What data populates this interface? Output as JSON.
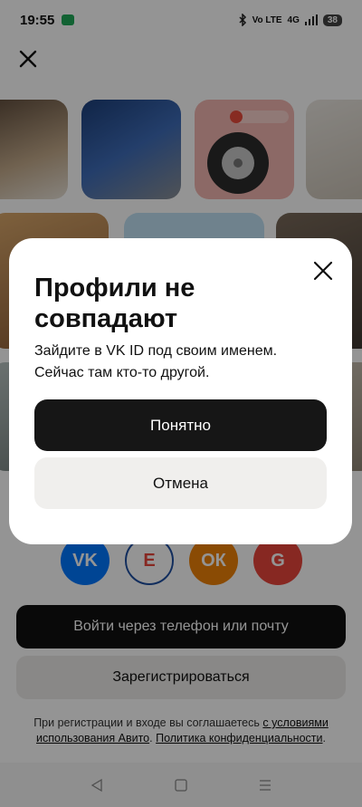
{
  "status_bar": {
    "time": "19:55",
    "network": "4G",
    "volte": "Vo LTE",
    "battery": "38"
  },
  "login": {
    "phone_button": "Войти через телефон или почту",
    "register_button": "Зарегистрироваться",
    "terms_prefix": "При регистрации и входе вы соглашаетесь ",
    "terms_link1": "с условиями использования Авито",
    "terms_middle": ". ",
    "terms_link2": "Политика конфиденциальности",
    "terms_suffix": ".",
    "social": [
      {
        "label": "VK",
        "color": "#0077ff"
      },
      {
        "label": "Е",
        "color": "#ffffff"
      },
      {
        "label": "ОК",
        "color": "#ee8208"
      },
      {
        "label": "G",
        "color": "#e8453c"
      }
    ]
  },
  "dialog": {
    "title": "Профили не совпадают",
    "subtitle": "Зайдите в VK ID под своим именем. Сейчас там кто-то другой.",
    "ok_button": "Понятно",
    "cancel_button": "Отмена"
  },
  "colors": {
    "primary": "#161616",
    "secondary": "#f0efed",
    "overlay": "rgba(0,0,0,0.42)"
  }
}
